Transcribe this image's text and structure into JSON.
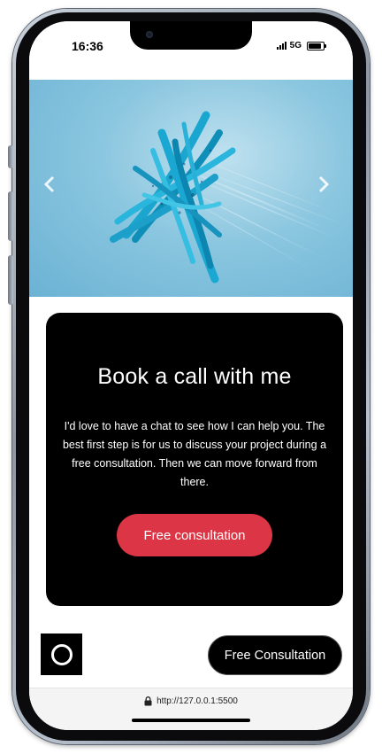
{
  "status_bar": {
    "time": "16:36",
    "network": "5G",
    "battery_level": 0.85
  },
  "hero": {
    "prev_icon": "chevron-left-icon",
    "next_icon": "chevron-right-icon"
  },
  "card": {
    "title": "Book a call with me",
    "text": "I'd love to have a chat to see how I can help you. The best first step is for us to discuss your project during a free consultation. Then we can move forward from there.",
    "button_label": "Free consultation",
    "button_color": "#dc3545",
    "background": "#000000"
  },
  "footer": {
    "logo_icon": "ring-logo-icon",
    "button_label": "Free Consultation"
  },
  "browser": {
    "lock_icon": "lock-icon",
    "url": "http://127.0.0.1:5500"
  }
}
